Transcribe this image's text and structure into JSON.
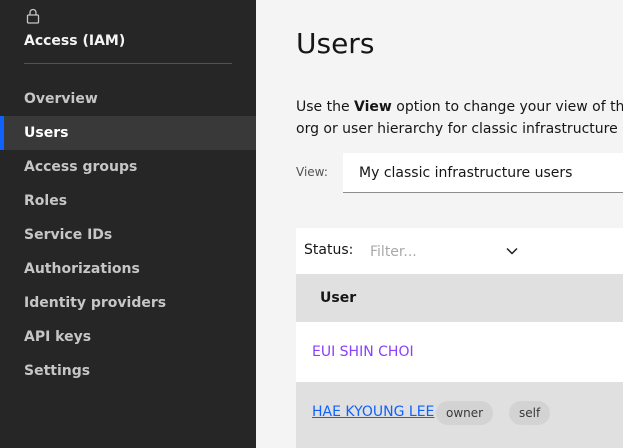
{
  "sidebar": {
    "title": "Access (IAM)",
    "items": [
      {
        "label": "Overview"
      },
      {
        "label": "Users",
        "active": true
      },
      {
        "label": "Access groups"
      },
      {
        "label": "Roles"
      },
      {
        "label": "Service IDs"
      },
      {
        "label": "Authorizations"
      },
      {
        "label": "Identity providers"
      },
      {
        "label": "API keys"
      },
      {
        "label": "Settings"
      }
    ]
  },
  "main": {
    "title": "Users",
    "description": {
      "part1": "Use the ",
      "bold": "View",
      "part2": " option to change your view of the use",
      "line2": "org or user hierarchy for classic infrastructure acce"
    },
    "view": {
      "label": "View:",
      "selected": "My classic infrastructure users"
    },
    "table": {
      "status_label": "Status:",
      "filter_placeholder": "Filter...",
      "columns": [
        "User"
      ],
      "rows": [
        {
          "user": "EUI SHIN CHOI",
          "tags": []
        },
        {
          "user": "HAE KYOUNG LEE",
          "tags": [
            "owner",
            "self"
          ]
        }
      ]
    }
  },
  "colors": {
    "sidebar_bg": "#262626",
    "accent": "#0f62fe",
    "visited_link": "#8a3ffc"
  }
}
